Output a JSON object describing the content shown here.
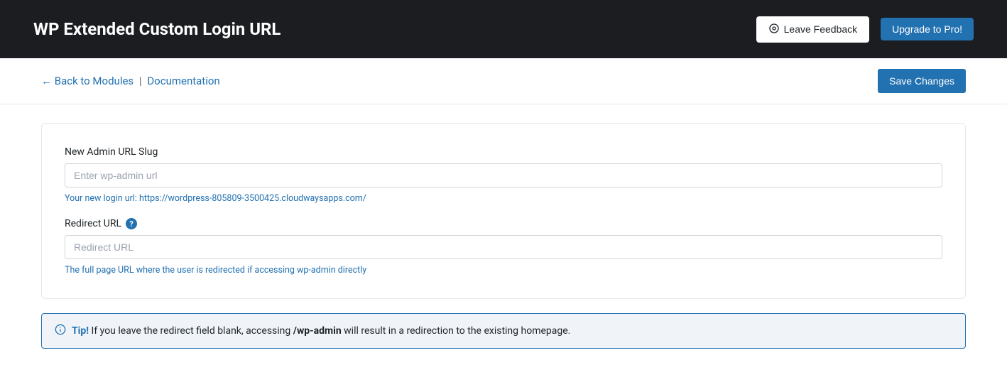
{
  "header": {
    "title": "WP Extended Custom Login URL",
    "feedback_label": "Leave Feedback",
    "upgrade_label": "Upgrade to Pro!"
  },
  "subheader": {
    "back_label": "← Back to Modules",
    "separator": "|",
    "docs_label": "Documentation",
    "save_label": "Save Changes"
  },
  "form": {
    "admin_slug": {
      "label": "New Admin URL Slug",
      "placeholder": "Enter wp-admin url",
      "value": "",
      "help": "Your new login url: https://wordpress-805809-3500425.cloudwaysapps.com/"
    },
    "redirect_url": {
      "label": "Redirect URL",
      "help_badge": "?",
      "placeholder": "Redirect URL",
      "value": "",
      "help": "The full page URL where the user is redirected if accessing wp-admin directly"
    }
  },
  "tip": {
    "label": "Tip!",
    "text_before": " If you leave the redirect field blank, accessing ",
    "bold": "/wp-admin",
    "text_after": " will result in a redirection to the existing homepage."
  }
}
